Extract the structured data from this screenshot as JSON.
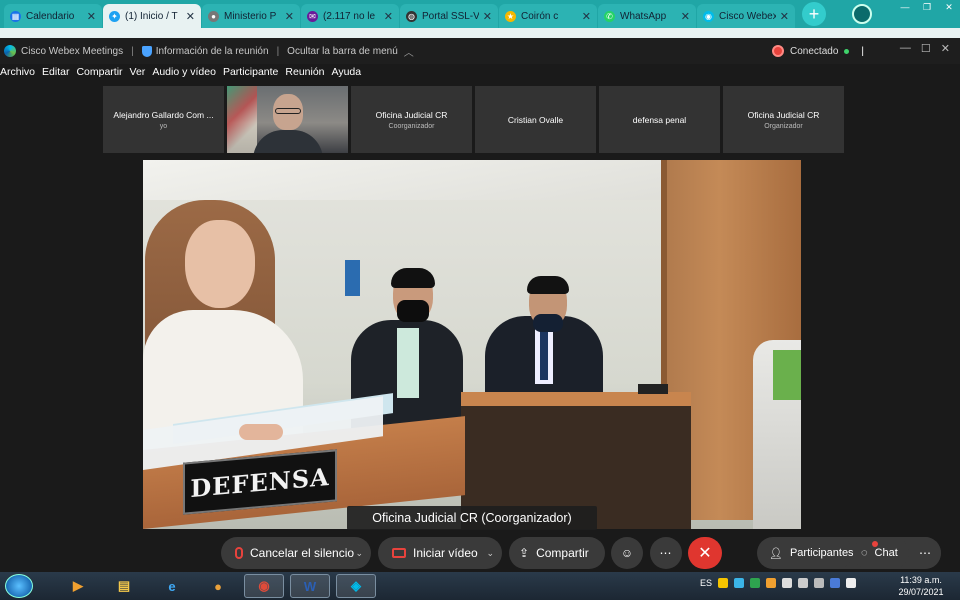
{
  "browser": {
    "tabs": [
      {
        "title": "Calendario",
        "icon": "calendar-icon",
        "color": "#1a73e8"
      },
      {
        "title": "(1) Inicio / T",
        "icon": "twitter-icon",
        "color": "#1da1f2",
        "active": true
      },
      {
        "title": "Ministerio P",
        "icon": "globe-icon",
        "color": "#777777"
      },
      {
        "title": "(2.117 no le",
        "icon": "mail-icon",
        "color": "#6a1b9a"
      },
      {
        "title": "Portal SSL-V",
        "icon": "portal-icon",
        "color": "#333333"
      },
      {
        "title": "Coirón c",
        "icon": "star-icon",
        "color": "#f5b800"
      },
      {
        "title": "WhatsApp",
        "icon": "whatsapp-icon",
        "color": "#25d366"
      },
      {
        "title": "Cisco Webex",
        "icon": "webex-icon",
        "color": "#00bceb"
      }
    ],
    "new_tab": "+"
  },
  "webex": {
    "app_title": "Cisco Webex Meetings",
    "meeting_info": "Información de la reunión",
    "hide_menu": "Ocultar la barra de menú",
    "status": "Conectado",
    "menu": [
      "Archivo",
      "Editar",
      "Compartir",
      "Ver",
      "Audio y vídeo",
      "Participante",
      "Reunión",
      "Ayuda"
    ],
    "thumbnails": [
      {
        "name": "Alejandro Gallardo Com ...",
        "role": "yo",
        "video": false
      },
      {
        "name": "",
        "role": "",
        "video": true
      },
      {
        "name": "Oficina Judicial CR",
        "role": "Coorganizador",
        "video": false
      },
      {
        "name": "Cristian Ovalle",
        "role": "",
        "video": false
      },
      {
        "name": "defensa penal",
        "role": "",
        "video": false
      },
      {
        "name": "Oficina Judicial CR",
        "role": "Organizador",
        "video": false
      }
    ],
    "video_label": "Oficina Judicial CR (Coorganizador)",
    "nameplate": "DEFENSA",
    "controls": {
      "mute": "Cancelar el silencio",
      "video": "Iniciar vídeo",
      "share": "Compartir",
      "participants": "Participantes",
      "chat": "Chat"
    }
  },
  "taskbar": {
    "language": "ES",
    "time": "11:39 a.m.",
    "date": "29/07/2021"
  },
  "colors": {
    "accent": "#20a6a6",
    "end_call": "#e0362f",
    "connected": "#3fd36b"
  }
}
